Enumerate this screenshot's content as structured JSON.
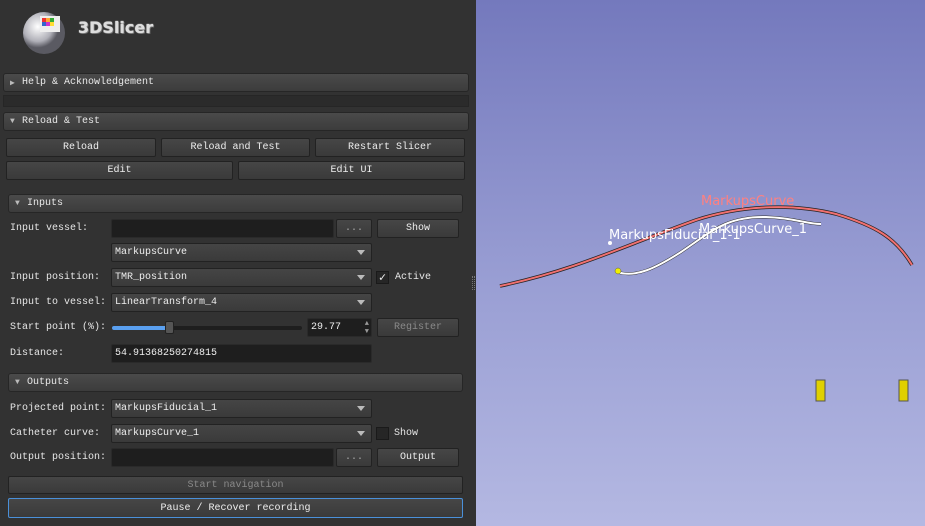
{
  "app": {
    "logo_text": "3DSlicer"
  },
  "sections": {
    "help": {
      "label": "Help & Acknowledgement",
      "expanded": false
    },
    "reload": {
      "label": "Reload & Test",
      "expanded": true,
      "buttons": {
        "reload": "Reload",
        "reload_test": "Reload and Test",
        "restart": "Restart Slicer",
        "edit": "Edit",
        "edit_ui": "Edit UI"
      }
    },
    "inputs": {
      "label": "Inputs",
      "input_vessel_label": "Input vessel:",
      "input_vessel_value": "",
      "browse": "...",
      "show": "Show",
      "vessel_curve": "MarkupsCurve",
      "input_position_label": "Input position:",
      "input_position": "TMR_position",
      "active_label": "Active",
      "active_checked": true,
      "input_to_vessel_label": "Input to vessel:",
      "input_to_vessel": "LinearTransform_4",
      "start_point_label": "Start point (%):",
      "start_point": "29.77",
      "start_point_percent": 29.77,
      "register": "Register",
      "distance_label": "Distance:",
      "distance": "54.91368250274815"
    },
    "outputs": {
      "label": "Outputs",
      "projected_label": "Projected point:",
      "projected": "MarkupsFiducial_1",
      "catheter_label": "Catheter curve:",
      "catheter": "MarkupsCurve_1",
      "show_label": "Show",
      "show_checked": false,
      "output_position_label": "Output position:",
      "output_position_value": "",
      "browse": "...",
      "output": "Output",
      "start_navigation": "Start navigation",
      "pause_recover": "Pause / Recover recording"
    }
  },
  "view3d": {
    "labels": {
      "curve": "MarkupsCurve",
      "curve1": "MarkupsCurve_1",
      "fiducial": "MarkupsFiducial_1-1"
    },
    "colors": {
      "curve": "#f07070",
      "curve1": "#ffffff",
      "fiducial_point": "#f0f000",
      "label_curve": "#ff8080"
    }
  }
}
